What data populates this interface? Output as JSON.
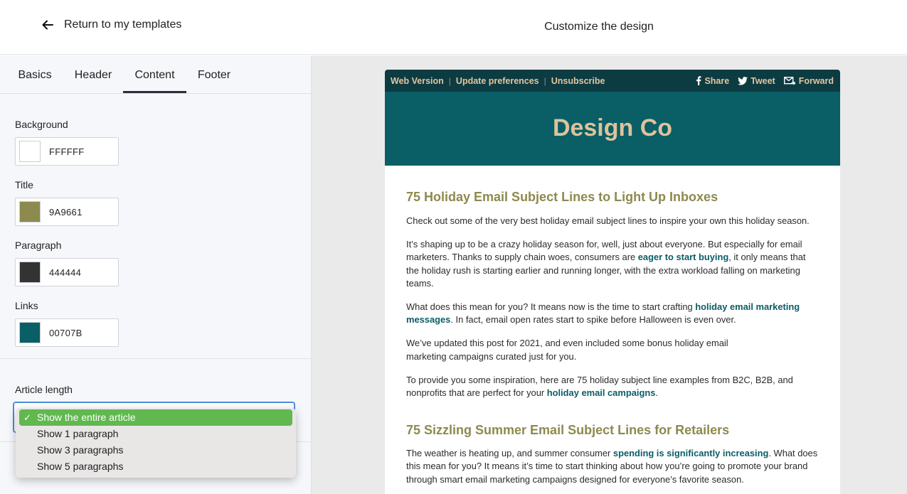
{
  "topbar": {
    "back_label": "Return to my templates",
    "title": "Customize the design"
  },
  "tabs": [
    "Basics",
    "Header",
    "Content",
    "Footer"
  ],
  "active_tab": "Content",
  "colors": {
    "background": {
      "label": "Background",
      "hex": "FFFFFF",
      "color": "#FFFFFF"
    },
    "title": {
      "label": "Title",
      "hex": "9A9661",
      "color": "#8c8a4e"
    },
    "paragraph": {
      "label": "Paragraph",
      "hex": "444444",
      "color": "#333333"
    },
    "links": {
      "label": "Links",
      "hex": "00707B",
      "color": "#0a5e66"
    }
  },
  "article_length": {
    "label": "Article length",
    "selected": "Show the entire article",
    "options": [
      "Show the entire article",
      "Show 1 paragraph",
      "Show 3 paragraphs",
      "Show 5 paragraphs"
    ]
  },
  "email": {
    "top_links": {
      "web_version": "Web Version",
      "update_preferences": "Update preferences",
      "unsubscribe": "Unsubscribe"
    },
    "share": {
      "share": "Share",
      "tweet": "Tweet",
      "forward": "Forward"
    },
    "brand": "Design Co",
    "article1": {
      "title": "75 Holiday Email Subject Lines to Light Up Inboxes",
      "p1": "Check out some of the very best holiday email subject lines to inspire your own this holiday season.",
      "p2a": "It’s shaping up to be a crazy holiday season for, well, just about everyone. But especially for email marketers. Thanks to supply chain woes, consumers are ",
      "p2link": "eager to start buying",
      "p2b": ", it only means that the holiday rush is starting earlier and running longer, with the extra workload falling on marketing teams.",
      "p3a": "What does this mean for you? It means now is the time to start crafting ",
      "p3link": "holiday email marketing messages",
      "p3b": ". In fact, email open rates start to spike before Halloween is even over.",
      "p4_line1": "We’ve updated this post for 2021, and even included some bonus holiday email",
      "p4_line2": "marketing campaigns curated just for you.",
      "p5a": "To provide you some inspiration, here are 75 holiday subject line examples from B2C, B2B, and nonprofits that are perfect for your ",
      "p5link": "holiday email campaigns",
      "p5b": "."
    },
    "article2": {
      "title": "75 Sizzling Summer Email Subject Lines for Retailers",
      "p1a": "The weather is heating up, and summer consumer ",
      "p1link": "spending is significantly increasing",
      "p1b": ". What does this mean for you? It means it’s time to start thinking about how you’re going to promote your brand through smart email marketing campaigns designed for everyone’s favorite season."
    }
  }
}
